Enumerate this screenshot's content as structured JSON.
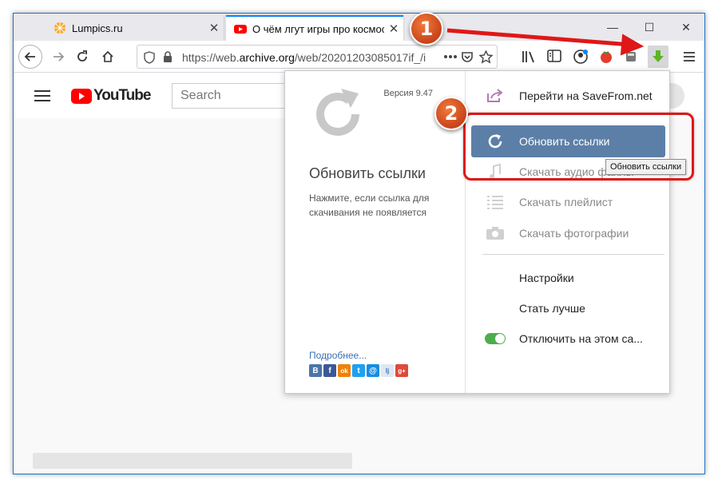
{
  "browser": {
    "tabs": [
      {
        "label": "Lumpics.ru",
        "close": "✕"
      },
      {
        "label": "О чём лгут игры про космос",
        "close": "✕"
      }
    ],
    "window_controls": {
      "minimize": "—",
      "maximize": "☐",
      "close": "✕"
    },
    "url": {
      "prefix": "https://web.",
      "host": "archive.org",
      "path": "/web/20201203085017if_/i"
    },
    "accent_color": "#0a84ff"
  },
  "page": {
    "logo_text": "YouTube",
    "search_placeholder": "Search",
    "logo_color": "#ff0000"
  },
  "popup": {
    "version": "Версия 9.47",
    "left_title": "Обновить ссылки",
    "left_description": "Нажмите, если ссылка для скачивания не появляется",
    "more_link": "Подробнее...",
    "social_icons": [
      "В",
      "f",
      "ok",
      "t",
      "@",
      "lj",
      "g+"
    ],
    "menu": [
      {
        "label": "Перейти на SaveFrom.net",
        "icon": "share-icon"
      },
      {
        "label": "Обновить ссылки",
        "icon": "refresh-icon"
      },
      {
        "label": "Скачать аудио файлы",
        "icon": "music-note-icon"
      },
      {
        "label": "Скачать плейлист",
        "icon": "list-icon"
      },
      {
        "label": "Скачать фотографии",
        "icon": "camera-icon"
      },
      {
        "label": "Настройки"
      },
      {
        "label": "Стать лучше"
      },
      {
        "label": "Отключить на этом са...",
        "icon": "toggle-on-icon"
      }
    ],
    "tooltip": "Обновить ссылки",
    "highlight_color": "#5c7fa8"
  },
  "annotations": {
    "step1": "1",
    "step2": "2",
    "color": "#e01717"
  }
}
